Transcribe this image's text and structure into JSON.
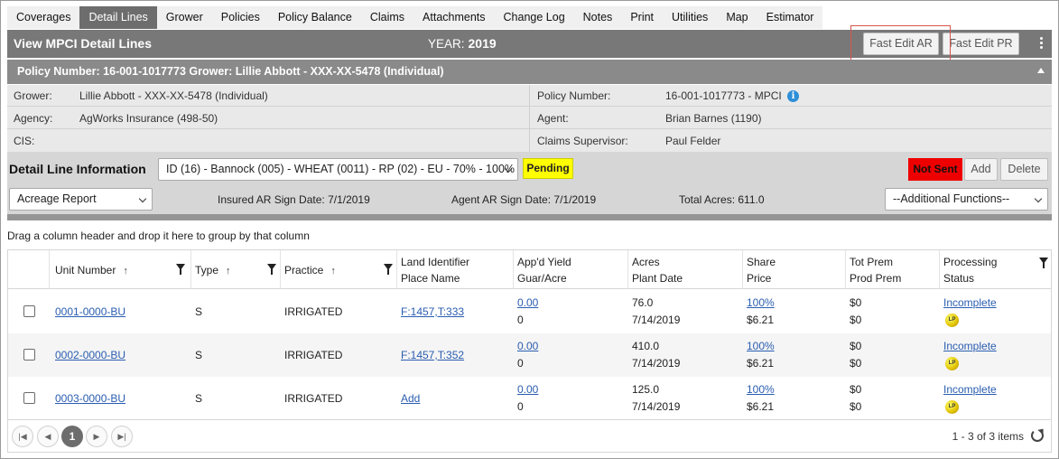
{
  "tabs": [
    {
      "label": "Coverages",
      "active": false
    },
    {
      "label": "Detail Lines",
      "active": true
    },
    {
      "label": "Grower",
      "active": false
    },
    {
      "label": "Policies",
      "active": false
    },
    {
      "label": "Policy Balance",
      "active": false
    },
    {
      "label": "Claims",
      "active": false
    },
    {
      "label": "Attachments",
      "active": false
    },
    {
      "label": "Change Log",
      "active": false
    },
    {
      "label": "Notes",
      "active": false
    },
    {
      "label": "Print",
      "active": false
    },
    {
      "label": "Utilities",
      "active": false
    },
    {
      "label": "Map",
      "active": false
    },
    {
      "label": "Estimator",
      "active": false
    }
  ],
  "header": {
    "title": "View MPCI Detail Lines",
    "year_label": "YEAR:",
    "year_value": "2019",
    "fast_edit_ar": "Fast Edit AR",
    "fast_edit_pr": "Fast Edit PR",
    "menu_icon": "kebab-menu-icon"
  },
  "policy_bar": {
    "text": "Policy Number: 16-001-1017773 Grower: Lillie Abbott - XXX-XX-5478 (Individual)",
    "collapse_icon": "triangle-up-icon"
  },
  "info": {
    "grower_label": "Grower:",
    "grower_value": "Lillie Abbott - XXX-XX-5478 (Individual)",
    "agency_label": "Agency:",
    "agency_value": "AgWorks Insurance (498-50)",
    "cis_label": "CIS:",
    "policy_label": "Policy Number:",
    "policy_value": "16-001-1017773 - MPCI",
    "info_icon": "info-icon",
    "agent_label": "Agent:",
    "agent_value": "Brian Barnes (1190)",
    "supervisor_label": "Claims Supervisor:",
    "supervisor_value": "Paul Felder"
  },
  "detail": {
    "heading": "Detail Line Information",
    "line_select": "ID (16) - Bannock (005) - WHEAT (0011) - RP (02) - EU - 70% - 100%",
    "status_badge": "Pending",
    "not_sent": "Not Sent",
    "add_label": "Add",
    "delete_label": "Delete",
    "report_select": "Acreage Report",
    "insured_sign": "Insured AR Sign Date: 7/1/2019",
    "agent_sign": "Agent AR Sign Date: 7/1/2019",
    "total_acres": "Total Acres: 611.0",
    "additional_functions": "--Additional Functions--"
  },
  "grid": {
    "group_hint": "Drag a column header and drop it here to group by that column",
    "headers": {
      "unit": "Unit Number",
      "type": "Type",
      "practice": "Practice",
      "land_1": "Land Identifier",
      "land_2": "Place Name",
      "yield_1": "App'd Yield",
      "yield_2": "Guar/Acre",
      "acres_1": "Acres",
      "acres_2": "Plant Date",
      "share_1": "Share",
      "share_2": "Price",
      "prem_1": "Tot Prem",
      "prem_2": "Prod Prem",
      "proc_1": "Processing",
      "proc_2": "Status"
    },
    "rows": [
      {
        "unit": "0001-0000-BU",
        "type": "S",
        "practice": "IRRIGATED",
        "land": "F:1457,T:333",
        "yield": "0.00",
        "guar": "0",
        "acres": "76.0",
        "plant": "7/14/2019",
        "share": "100%",
        "price": "$6.21",
        "tot_prem": "$0",
        "prod_prem": "$0",
        "status": "Incomplete",
        "badge": "LP"
      },
      {
        "unit": "0002-0000-BU",
        "type": "S",
        "practice": "IRRIGATED",
        "land": "F:1457,T:352",
        "yield": "0.00",
        "guar": "0",
        "acres": "410.0",
        "plant": "7/14/2019",
        "share": "100%",
        "price": "$6.21",
        "tot_prem": "$0",
        "prod_prem": "$0",
        "status": "Incomplete",
        "badge": "LP"
      },
      {
        "unit": "0003-0000-BU",
        "type": "S",
        "practice": "IRRIGATED",
        "land": "Add",
        "yield": "0.00",
        "guar": "0",
        "acres": "125.0",
        "plant": "7/14/2019",
        "share": "100%",
        "price": "$6.21",
        "tot_prem": "$0",
        "prod_prem": "$0",
        "status": "Incomplete",
        "badge": "LP"
      }
    ]
  },
  "pager": {
    "current_page": "1",
    "items_text": "1 - 3 of 3 items",
    "first_icon": "first-page-icon",
    "prev_icon": "prev-page-icon",
    "next_icon": "next-page-icon",
    "last_icon": "last-page-icon",
    "refresh_icon": "refresh-icon"
  }
}
